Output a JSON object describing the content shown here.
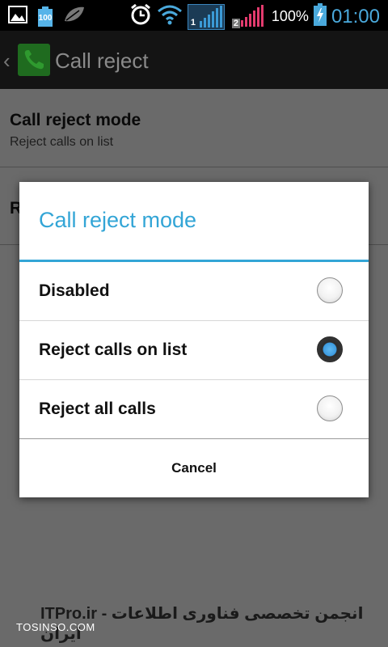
{
  "status_bar": {
    "battery_level": "100",
    "battery_percent": "100%",
    "time": "01:00",
    "sim1_label": "1",
    "sim2_label": "2",
    "colors": {
      "time": "#4aa9dc",
      "sim2_signal": "#e33b6e",
      "sim1_signal": "#3b9ad6"
    }
  },
  "action_bar": {
    "title": "Call reject",
    "back_icon": "chevron-left-icon",
    "app_icon": "phone-icon"
  },
  "settings_list": {
    "items": [
      {
        "title": "Call reject mode",
        "subtitle": "Reject calls on list"
      },
      {
        "title": "R"
      }
    ]
  },
  "dialog": {
    "title": "Call reject mode",
    "options": [
      {
        "label": "Disabled",
        "selected": false
      },
      {
        "label": "Reject calls on list",
        "selected": true
      },
      {
        "label": "Reject all calls",
        "selected": false
      }
    ],
    "cancel_label": "Cancel",
    "accent_color": "#33a5d6"
  },
  "watermark": {
    "line1": "ITPro.ir - انجمن تخصصی فناوری اطلاعات ایران",
    "line2": "TOSINSO.COM"
  }
}
